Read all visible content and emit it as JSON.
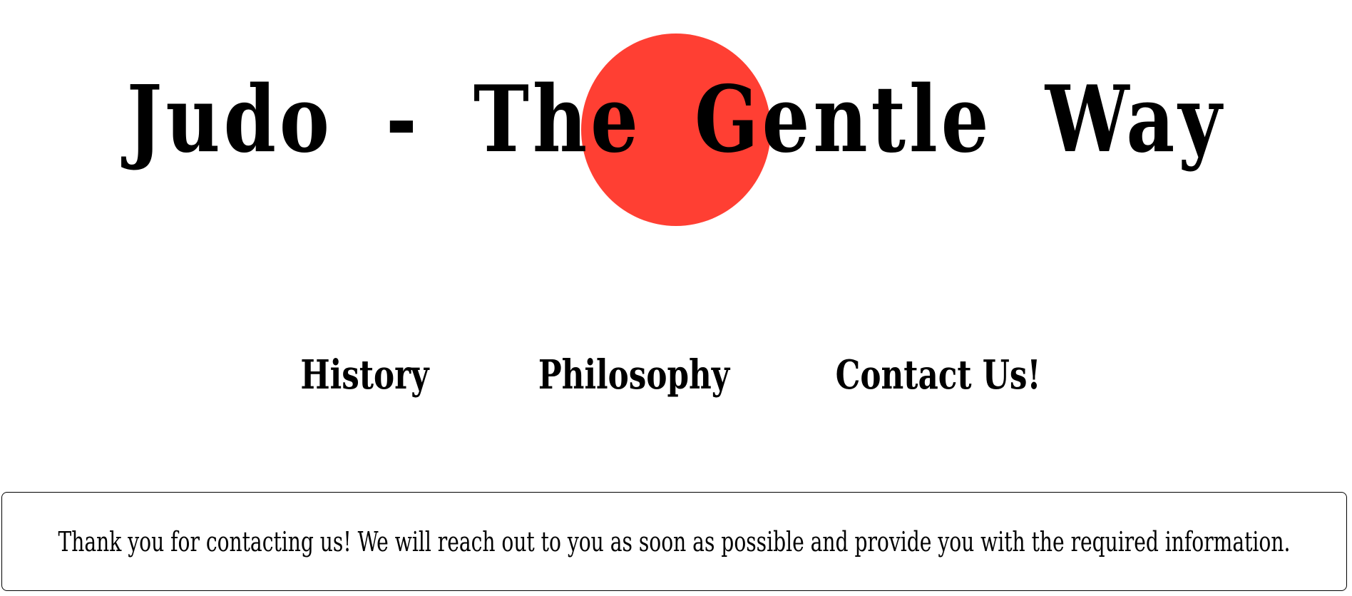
{
  "header": {
    "title": "Judo - The Gentle Way",
    "accent_color": "#ff3f33"
  },
  "nav": {
    "items": [
      {
        "label": "History"
      },
      {
        "label": "Philosophy"
      },
      {
        "label": "Contact Us!"
      }
    ]
  },
  "main": {
    "confirmation_message": "Thank you for contacting us! We will reach out to you as soon as possible and provide you with the required information."
  }
}
